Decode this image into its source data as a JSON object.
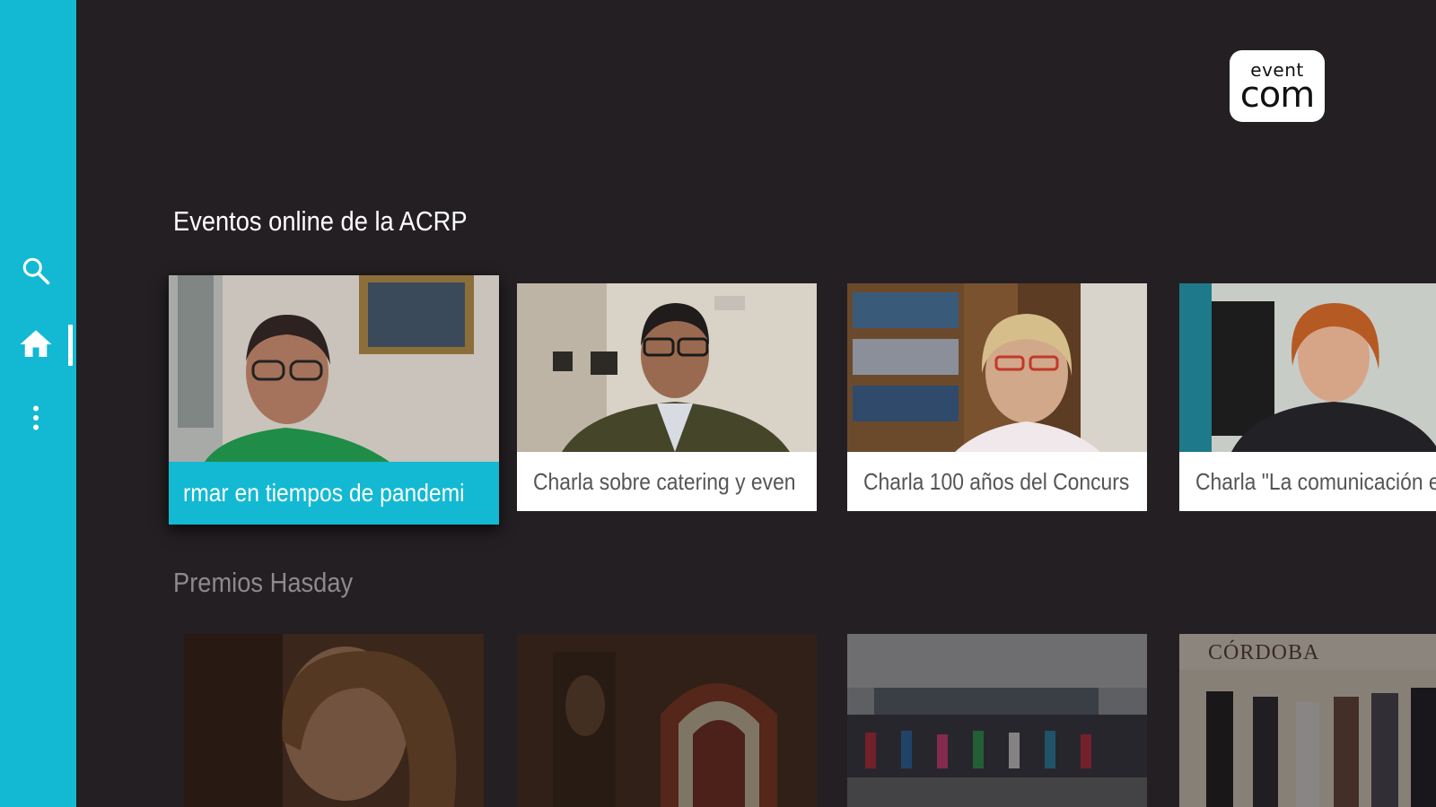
{
  "sidebar": {
    "items": [
      {
        "icon": "search-icon"
      },
      {
        "icon": "home-icon",
        "selected": true
      },
      {
        "icon": "more-vert-icon"
      }
    ],
    "accent_color": "#13b9d3"
  },
  "logo": {
    "top_text": "event",
    "bottom_text": "com"
  },
  "rows": [
    {
      "title": "Eventos online de la ACRP",
      "cards": [
        {
          "caption": "rmar en tiempos de pandemi",
          "focused": true
        },
        {
          "caption": "Charla sobre catering y even"
        },
        {
          "caption": "Charla 100 años del Concurs"
        },
        {
          "caption": "Charla \"La comunicación e"
        }
      ]
    },
    {
      "title": "Premios Hasday",
      "cards": [
        {
          "caption": ""
        },
        {
          "caption": ""
        },
        {
          "caption": ""
        },
        {
          "caption": "",
          "image_text": "CÓRDOBA"
        }
      ]
    }
  ],
  "colors": {
    "background": "#231f22",
    "accent": "#13b9d3",
    "caption_bg": "#ffffff",
    "caption_text": "#555555",
    "inactive_title": "#8d898c"
  }
}
